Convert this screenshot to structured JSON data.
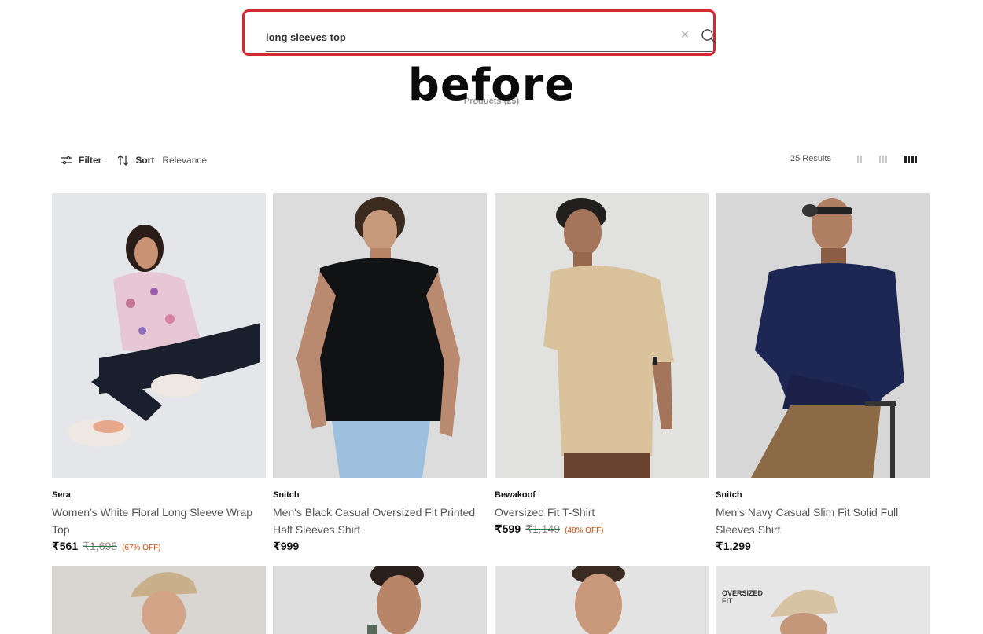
{
  "search": {
    "value": "long sleeves top",
    "placeholder": ""
  },
  "overlay": {
    "word": "before",
    "products_count": "Products (25)"
  },
  "toolbar": {
    "filter_label": "Filter",
    "sort_label": "Sort",
    "sort_value": "Relevance",
    "results": "25 Results"
  },
  "products": [
    {
      "brand": "Sera",
      "name": "Women's White Floral Long Sleeve Wrap Top",
      "price": "₹561",
      "mrp": "₹1,698",
      "discount": "(67% OFF)"
    },
    {
      "brand": "Snitch",
      "name": "Men's Black Casual Oversized Fit Printed Half Sleeves Shirt",
      "price": "₹999",
      "mrp": "",
      "discount": ""
    },
    {
      "brand": "Bewakoof",
      "name": "Oversized Fit T-Shirt",
      "price": "₹599",
      "mrp": "₹1,149",
      "discount": "(48% OFF)"
    },
    {
      "brand": "Snitch",
      "name": "Men's Navy Casual Slim Fit Solid Full Sleeves Shirt",
      "price": "₹1,299",
      "mrp": "",
      "discount": ""
    }
  ],
  "row2_badge": "OVERSIZED\nFIT",
  "colors": {
    "accent_border": "#d42a2f",
    "discount": "#d04a0a"
  }
}
